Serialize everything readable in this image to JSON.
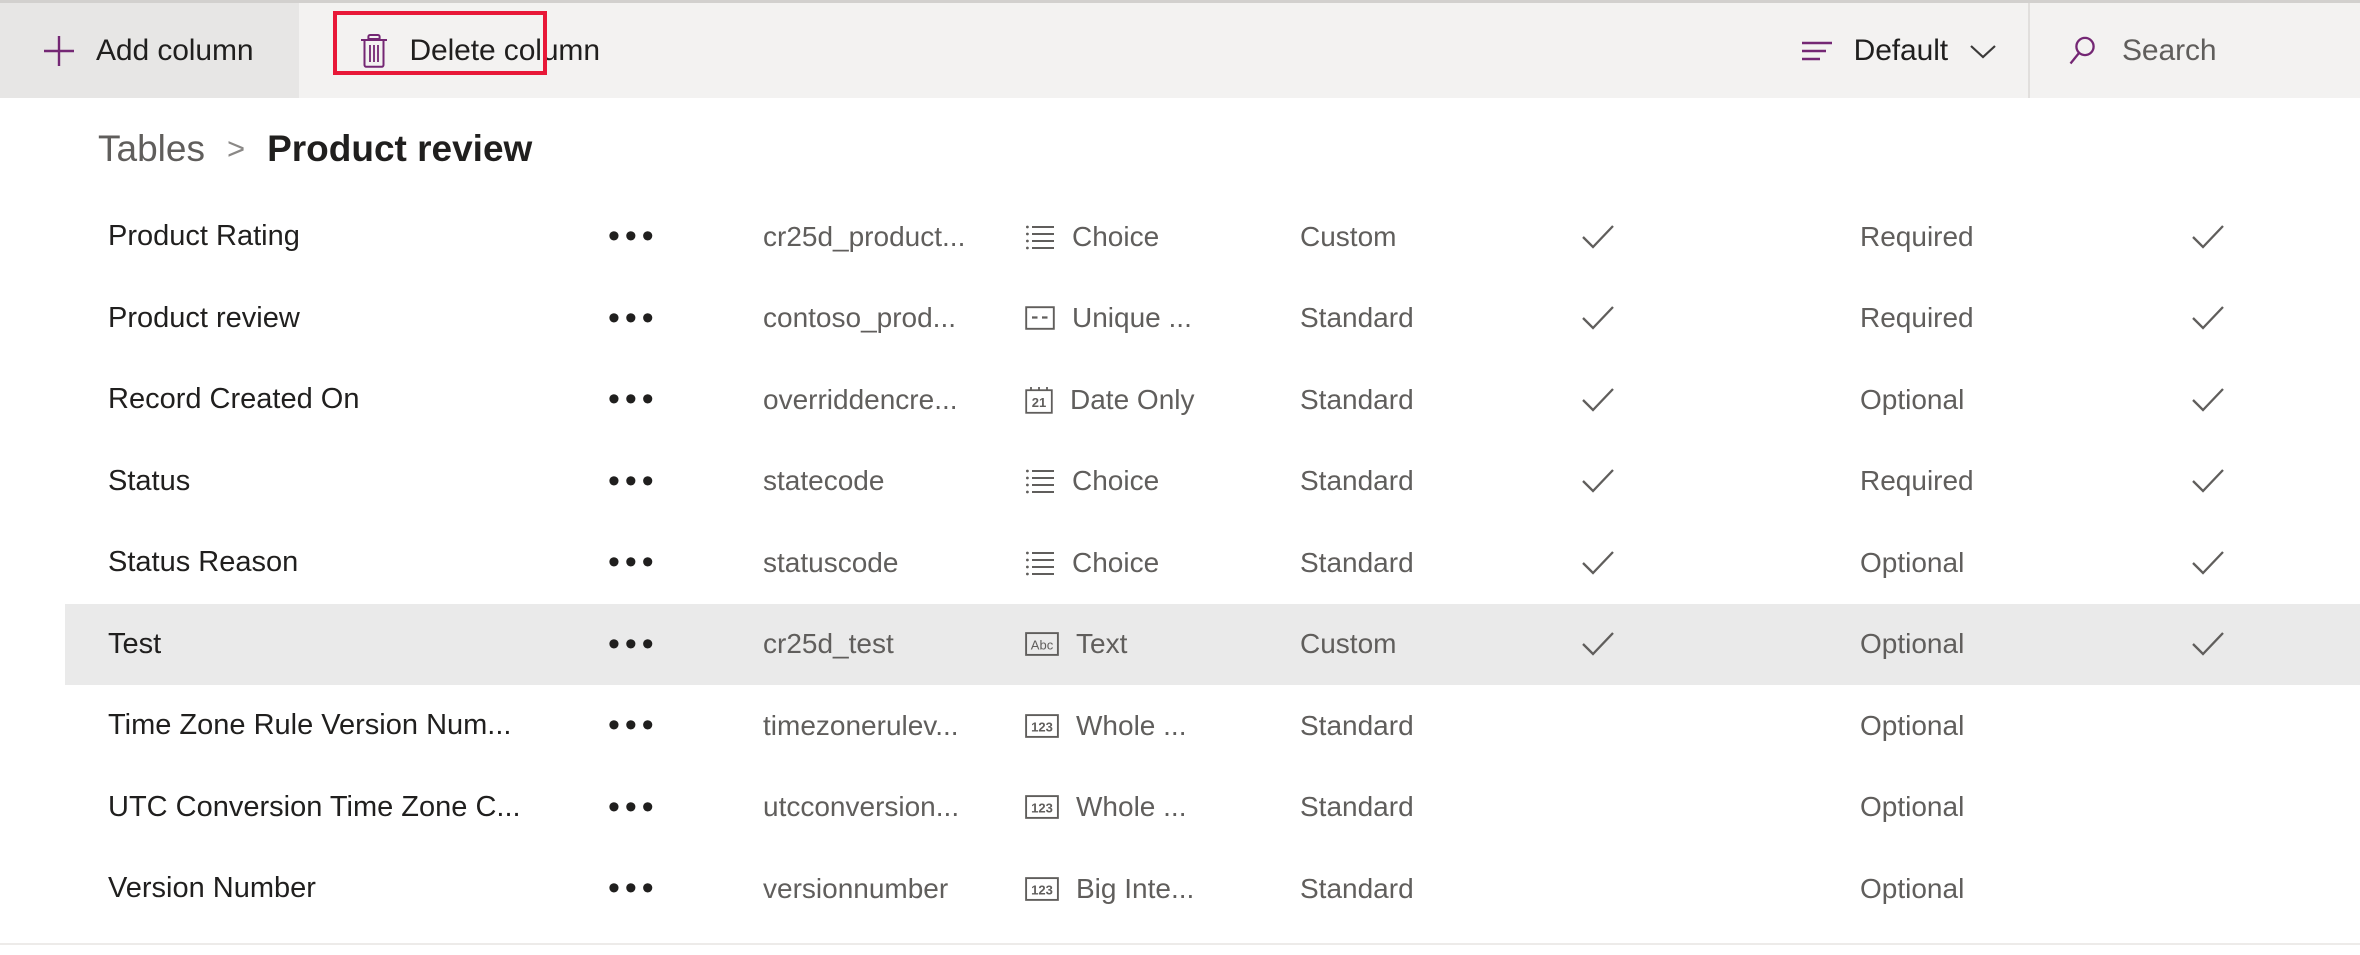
{
  "commandbar": {
    "add_column": {
      "label": "Add column",
      "icon": "plus-icon"
    },
    "delete_column": {
      "label": "Delete column",
      "icon": "trash-icon"
    },
    "view_picker": {
      "label": "Default",
      "icon": "view-list-icon",
      "chevron": "chevron-down-icon"
    },
    "search": {
      "placeholder": "Search",
      "icon": "search-icon"
    },
    "highlight_color": "#e81838",
    "accent_color": "#742774"
  },
  "breadcrumb": {
    "root": "Tables",
    "separator": ">",
    "current": "Product review"
  },
  "grid": {
    "row_menu_glyph": "•••",
    "rows": [
      {
        "display_name": "Product Rating",
        "logical_name": "cr25d_product...",
        "data_type": "Choice",
        "type_icon": "choice-list-icon",
        "custom_standard": "Custom",
        "check1": true,
        "requirement": "Required",
        "check2": true,
        "selected": false
      },
      {
        "display_name": "Product review",
        "logical_name": "contoso_prod...",
        "data_type": "Unique ...",
        "type_icon": "unique-identifier-icon",
        "custom_standard": "Standard",
        "check1": true,
        "requirement": "Required",
        "check2": true,
        "selected": false
      },
      {
        "display_name": "Record Created On",
        "logical_name": "overriddencre...",
        "data_type": "Date Only",
        "type_icon": "calendar-21-icon",
        "custom_standard": "Standard",
        "check1": true,
        "requirement": "Optional",
        "check2": true,
        "selected": false
      },
      {
        "display_name": "Status",
        "logical_name": "statecode",
        "data_type": "Choice",
        "type_icon": "choice-list-icon",
        "custom_standard": "Standard",
        "check1": true,
        "requirement": "Required",
        "check2": true,
        "selected": false
      },
      {
        "display_name": "Status Reason",
        "logical_name": "statuscode",
        "data_type": "Choice",
        "type_icon": "choice-list-icon",
        "custom_standard": "Standard",
        "check1": true,
        "requirement": "Optional",
        "check2": true,
        "selected": false
      },
      {
        "display_name": "Test",
        "logical_name": "cr25d_test",
        "data_type": "Text",
        "type_icon": "abc-text-icon",
        "custom_standard": "Custom",
        "check1": true,
        "requirement": "Optional",
        "check2": true,
        "selected": true
      },
      {
        "display_name": "Time Zone Rule Version Num...",
        "logical_name": "timezonerulev...",
        "data_type": "Whole ...",
        "type_icon": "number-123-icon",
        "custom_standard": "Standard",
        "check1": false,
        "requirement": "Optional",
        "check2": false,
        "selected": false
      },
      {
        "display_name": "UTC Conversion Time Zone C...",
        "logical_name": "utcconversion...",
        "data_type": "Whole ...",
        "type_icon": "number-123-icon",
        "custom_standard": "Standard",
        "check1": false,
        "requirement": "Optional",
        "check2": false,
        "selected": false
      },
      {
        "display_name": "Version Number",
        "logical_name": "versionnumber",
        "data_type": "Big Inte...",
        "type_icon": "number-123-icon",
        "custom_standard": "Standard",
        "check1": false,
        "requirement": "Optional",
        "check2": false,
        "selected": false
      }
    ]
  }
}
